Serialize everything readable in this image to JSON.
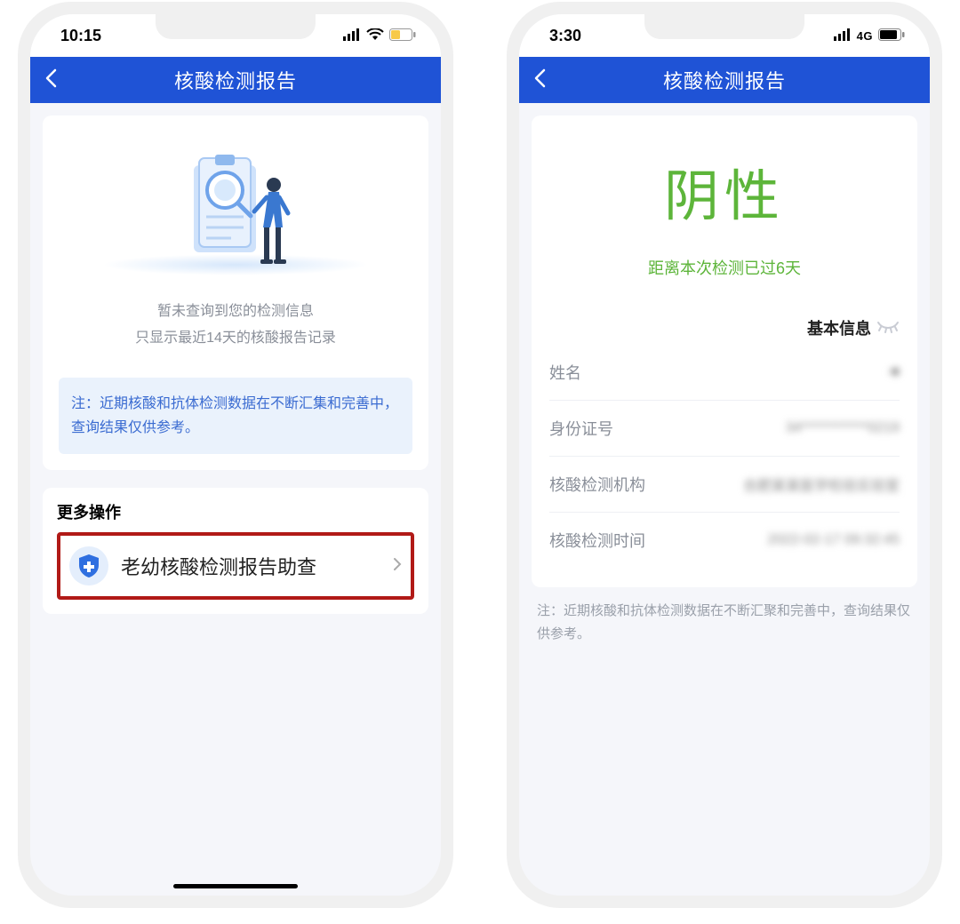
{
  "left": {
    "status": {
      "time": "10:15"
    },
    "nav": {
      "title": "核酸检测报告"
    },
    "empty": {
      "line1": "暂未查询到您的检测信息",
      "line2": "只显示最近14天的核酸报告记录"
    },
    "note": "注：近期核酸和抗体检测数据在不断汇集和完善中，查询结果仅供参考。",
    "more": {
      "title": "更多操作",
      "row_label": "老幼核酸检测报告助查"
    }
  },
  "right": {
    "status": {
      "time": "3:30",
      "network": "4G"
    },
    "nav": {
      "title": "核酸检测报告"
    },
    "result": {
      "text": "阴性",
      "subtitle": "距离本次检测已过6天"
    },
    "section_title": "基本信息",
    "fields": {
      "name_label": "姓名",
      "id_label": "身份证号",
      "org_label": "核酸检测机构",
      "time_label": "核酸检测时间",
      "name_value": "·■",
      "id_value": "34************0219",
      "org_value": "合肥某某医学检验实验室",
      "time_value": "2022-02-17 09:32:45"
    },
    "footnote": "注：近期核酸和抗体检测数据在不断汇聚和完善中，查询结果仅供参考。"
  }
}
